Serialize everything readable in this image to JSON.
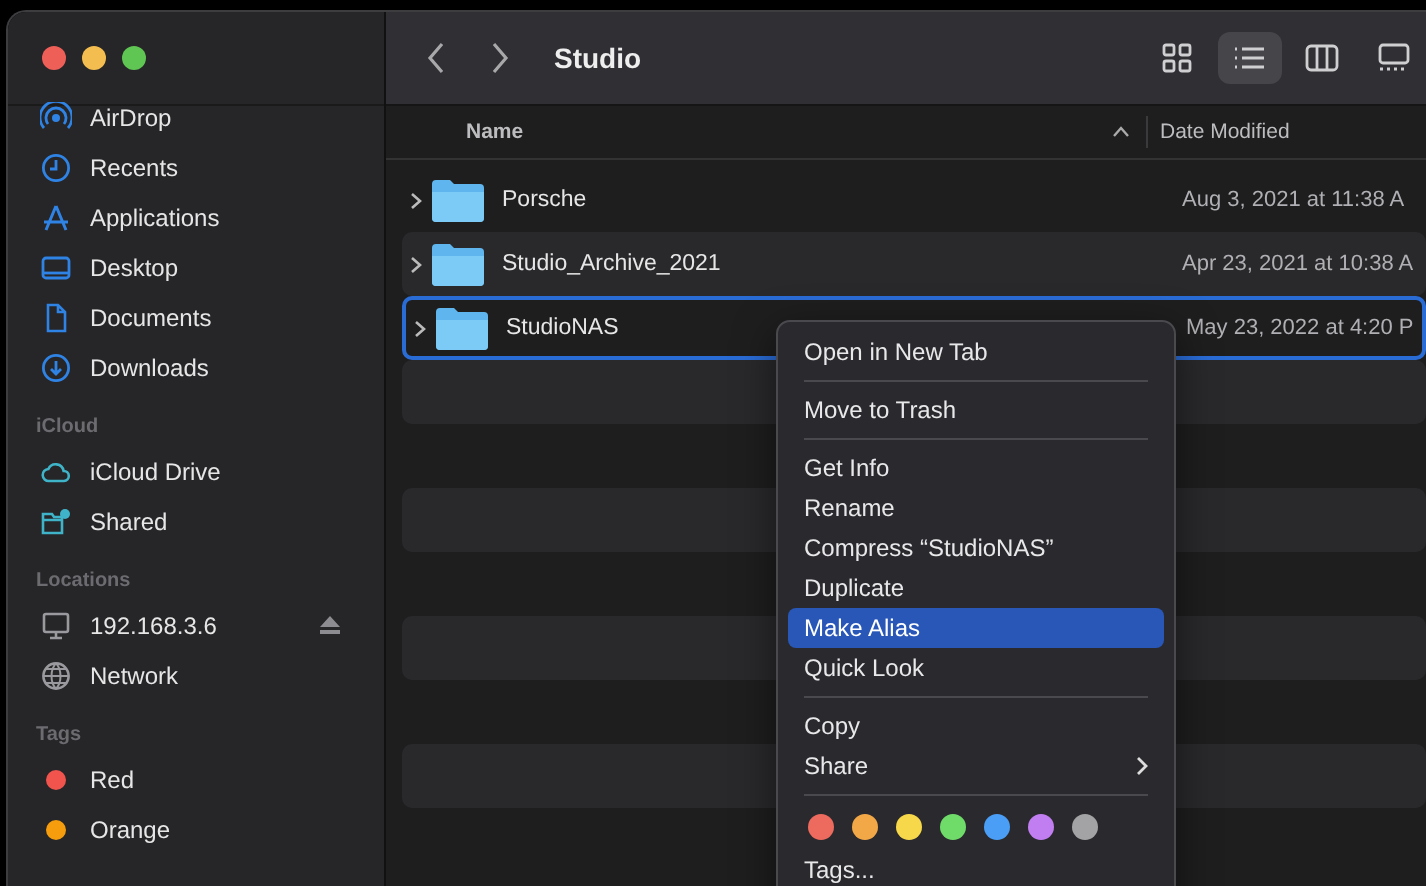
{
  "window": {
    "title": "Studio"
  },
  "sidebar": {
    "sections": [
      {
        "items": [
          {
            "label": "AirDrop"
          },
          {
            "label": "Recents"
          },
          {
            "label": "Applications"
          },
          {
            "label": "Desktop"
          },
          {
            "label": "Documents"
          },
          {
            "label": "Downloads"
          }
        ]
      },
      {
        "header": "iCloud",
        "items": [
          {
            "label": "iCloud Drive"
          },
          {
            "label": "Shared"
          }
        ]
      },
      {
        "header": "Locations",
        "items": [
          {
            "label": "192.168.3.6",
            "eject": true
          },
          {
            "label": "Network",
            "eject": false
          }
        ]
      },
      {
        "header": "Tags",
        "items": [
          {
            "label": "Red",
            "color": "#f0544c"
          },
          {
            "label": "Orange",
            "color": "#f59d0d"
          }
        ]
      }
    ]
  },
  "view_modes": [
    {
      "kind": "grid",
      "selected": false
    },
    {
      "kind": "list",
      "selected": true
    },
    {
      "kind": "columns",
      "selected": false
    },
    {
      "kind": "gallery",
      "selected": false
    }
  ],
  "table": {
    "columns": [
      {
        "label": "Name",
        "sorted": true
      },
      {
        "label": "Date Modified",
        "sorted": false
      }
    ],
    "rows": [
      {
        "name": "Porsche",
        "date": "Aug 3, 2021 at 11:38 A",
        "selected": false
      },
      {
        "name": "Studio_Archive_2021",
        "date": "Apr 23, 2021 at 10:38 A",
        "selected": false
      },
      {
        "name": "StudioNAS",
        "date": "May 23, 2022 at 4:20 P",
        "selected": true
      }
    ]
  },
  "context_menu": {
    "groups": [
      [
        {
          "label": "Open in New Tab",
          "selected": false
        }
      ],
      [
        {
          "label": "Move to Trash",
          "selected": false
        }
      ],
      [
        {
          "label": "Get Info",
          "selected": false
        },
        {
          "label": "Rename",
          "selected": false
        },
        {
          "label": "Compress “StudioNAS”",
          "selected": false
        },
        {
          "label": "Duplicate",
          "selected": false
        },
        {
          "label": "Make Alias",
          "selected": true
        },
        {
          "label": "Quick Look",
          "selected": false
        }
      ],
      [
        {
          "label": "Copy",
          "selected": false,
          "submenu": false
        },
        {
          "label": "Share",
          "selected": false,
          "submenu": true
        }
      ]
    ],
    "tags": [
      {
        "color": "#ec6a5e"
      },
      {
        "color": "#f3a847"
      },
      {
        "color": "#f7d84a"
      },
      {
        "color": "#6fdc6a"
      },
      {
        "color": "#4a9ef5"
      },
      {
        "color": "#c17ef0"
      },
      {
        "color": "#a3a3a6"
      }
    ],
    "footer": "Tags..."
  }
}
